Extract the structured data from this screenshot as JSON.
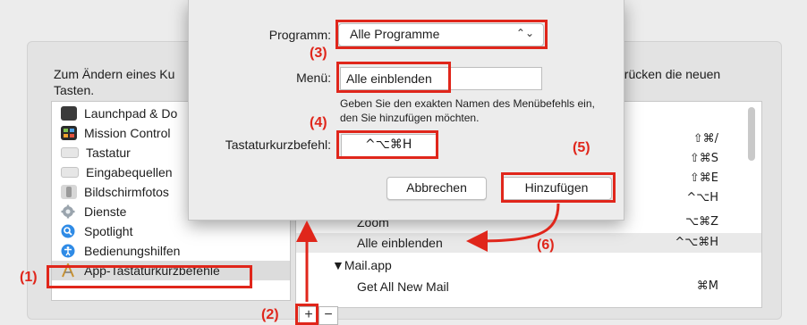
{
  "instructions": {
    "left": "Zum Ändern eines Ku Tasten.",
    "right": "drücken die neuen"
  },
  "left_list": {
    "items": [
      {
        "label": "Launchpad & Do",
        "icon": "launchpad-icon"
      },
      {
        "label": "Mission Control",
        "icon": "mission-control-icon"
      },
      {
        "label": "Tastatur",
        "icon": "keyboard-icon"
      },
      {
        "label": "Eingabequellen",
        "icon": "input-sources-icon"
      },
      {
        "label": "Bildschirmfotos",
        "icon": "screenshot-icon"
      },
      {
        "label": "Dienste",
        "icon": "gear-icon"
      },
      {
        "label": "Spotlight",
        "icon": "spotlight-icon"
      },
      {
        "label": "Bedienungshilfen",
        "icon": "accessibility-icon"
      },
      {
        "label": "App-Tastaturkurzbefehle",
        "icon": "app-shortcuts-icon",
        "selected": true
      }
    ]
  },
  "right_list": {
    "items": [
      {
        "name": "",
        "shortcut": "⇧⌘/"
      },
      {
        "name": "",
        "shortcut": "⇧⌘S"
      },
      {
        "name": "",
        "shortcut": "⇧⌘E"
      },
      {
        "name": "",
        "shortcut": "^⌥H"
      },
      {
        "name": "Zoom",
        "shortcut": "⌥⌘Z"
      },
      {
        "name": "Alle einblenden",
        "shortcut": "^⌥⌘H",
        "selected": true
      },
      {
        "name": "▼Mail.app",
        "shortcut": ""
      },
      {
        "name": "Get All New Mail",
        "shortcut": "⌘M"
      }
    ]
  },
  "controls": {
    "add": "+",
    "remove": "−"
  },
  "dialog": {
    "program_label": "Programm:",
    "program_value": "Alle Programme",
    "program_arrow": "⌃⌄",
    "menu_label": "Menü:",
    "menu_value": "Alle einblenden",
    "hint": "Geben Sie den exakten Namen des Menübefehls ein, den Sie hinzufügen möchten.",
    "shortcut_label": "Tastaturkurzbefehl:",
    "shortcut_value": "^⌥⌘H",
    "cancel_label": "Abbrechen",
    "add_label": "Hinzufügen"
  },
  "annotations": {
    "step1": "(1)",
    "step2": "(2)",
    "step3": "(3)",
    "step4": "(4)",
    "step5": "(5)",
    "step6": "(6)",
    "color": "#e0261b"
  }
}
